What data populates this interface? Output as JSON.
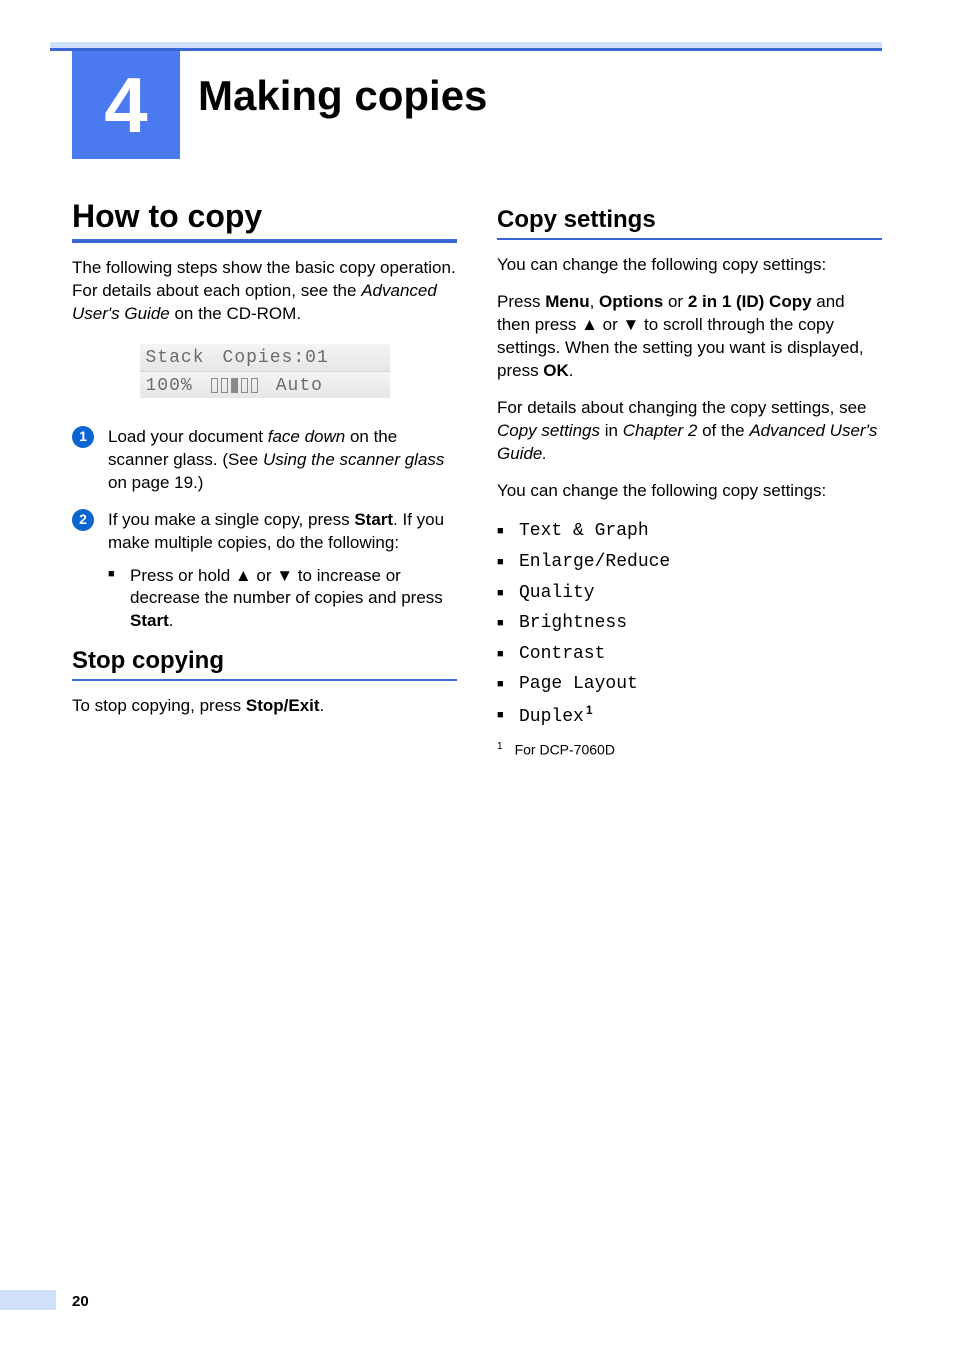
{
  "chapter": {
    "number": "4",
    "title": "Making copies"
  },
  "left": {
    "h1": "How to copy",
    "intro_a": "The following steps show the basic copy operation. For details about each option, see the ",
    "intro_em": "Advanced User's Guide",
    "intro_b": " on the CD-ROM.",
    "lcd": {
      "r1a": "Stack",
      "r1b": "Copies:01",
      "r2a": "100%",
      "r2c": "Auto"
    },
    "step1_a": "Load your document ",
    "step1_em": "face down",
    "step1_b": " on the scanner glass. (See ",
    "step1_em2": "Using the scanner glass",
    "step1_c": " on page 19.)",
    "step2_a": "If you make a single copy, press ",
    "step2_bold": "Start",
    "step2_b": ". If you make multiple copies, do the following:",
    "step2_sub_a": "Press or hold ▲ or ▼ to increase or decrease the number of copies and press ",
    "step2_sub_bold": "Start",
    "step2_sub_b": ".",
    "h2_stop": "Stop copying",
    "stop_a": "To stop copying, press ",
    "stop_bold": "Stop/Exit",
    "stop_b": "."
  },
  "right": {
    "h2": "Copy settings",
    "p1": "You can change the following copy settings:",
    "p2_a": "Press ",
    "p2_b1": "Menu",
    "p2_c1": ", ",
    "p2_b2": "Options",
    "p2_c2": " or ",
    "p2_b3": "2 in 1 (ID) Copy",
    "p2_c3": " and then press ▲ or ▼ to scroll through the copy settings. When the setting you want is displayed, press ",
    "p2_b4": "OK",
    "p2_c4": ".",
    "p3_a": "For details about changing the copy settings, see ",
    "p3_em1": "Copy settings",
    "p3_b": " in ",
    "p3_em2": "Chapter 2",
    "p3_c": " of the ",
    "p3_em3": "Advanced User's Guide.",
    "p4": "You can change the following copy settings:",
    "settings": [
      "Text & Graph",
      "Enlarge/Reduce",
      "Quality",
      "Brightness",
      "Contrast",
      "Page Layout"
    ],
    "setting_last": "Duplex",
    "setting_last_sup": "1",
    "footnote_sup": "1",
    "footnote": "For DCP-7060D"
  },
  "page_number": "20"
}
